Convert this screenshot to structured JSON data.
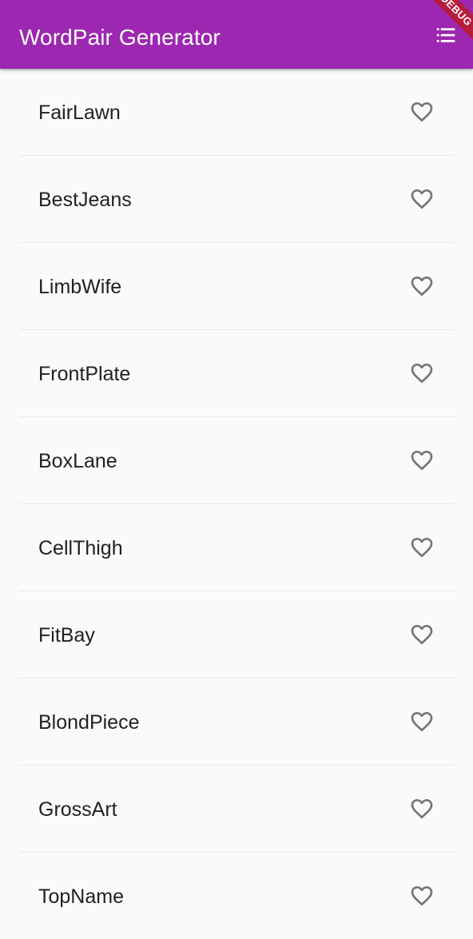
{
  "app": {
    "title": "WordPair Generator",
    "debug_banner": "DEBUG",
    "accent_color": "#9c27b0",
    "list_icon": "list-icon"
  },
  "word_pairs": [
    {
      "label": "FairLawn",
      "favorite": false,
      "icon": "heart-outline-icon"
    },
    {
      "label": "BestJeans",
      "favorite": false,
      "icon": "heart-outline-icon"
    },
    {
      "label": "LimbWife",
      "favorite": false,
      "icon": "heart-outline-icon"
    },
    {
      "label": "FrontPlate",
      "favorite": false,
      "icon": "heart-outline-icon"
    },
    {
      "label": "BoxLane",
      "favorite": false,
      "icon": "heart-outline-icon"
    },
    {
      "label": "CellThigh",
      "favorite": false,
      "icon": "heart-outline-icon"
    },
    {
      "label": "FitBay",
      "favorite": false,
      "icon": "heart-outline-icon"
    },
    {
      "label": "BlondPiece",
      "favorite": false,
      "icon": "heart-outline-icon"
    },
    {
      "label": "GrossArt",
      "favorite": false,
      "icon": "heart-outline-icon"
    },
    {
      "label": "TopName",
      "favorite": false,
      "icon": "heart-outline-icon"
    }
  ]
}
